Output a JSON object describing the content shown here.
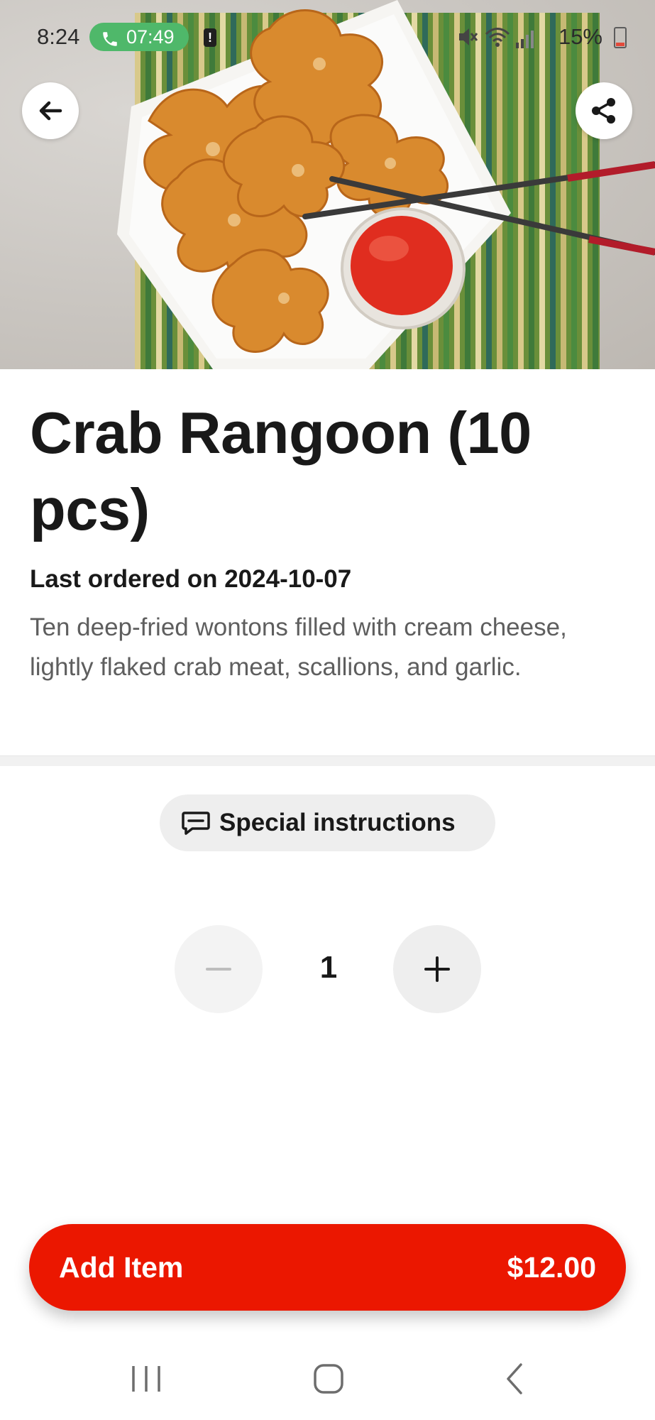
{
  "status_bar": {
    "time": "8:24",
    "call_timer": "07:49",
    "battery": "15%",
    "icons": [
      "phone-icon",
      "alert-icon",
      "mute-icon",
      "wifi-icon",
      "signal-icon",
      "battery-icon"
    ]
  },
  "header": {
    "back_icon": "arrow-left-icon",
    "share_icon": "share-icon"
  },
  "item": {
    "title": "Crab Rangoon (10 pcs)",
    "last_ordered": "Last ordered on 2024-10-07",
    "description": "Ten deep-fried wontons filled with cream cheese, lightly flaked crab meat, scallions, and garlic."
  },
  "special_instructions": {
    "label": "Special instructions",
    "icon": "message-icon"
  },
  "quantity": {
    "value": "1",
    "minus_icon": "minus-icon",
    "plus_icon": "plus-icon"
  },
  "cta": {
    "label": "Add Item",
    "price": "$12.00"
  },
  "colors": {
    "brand": "#eb1700",
    "call_pill": "#4fb86a"
  },
  "nav": {
    "icons": [
      "recent-apps-icon",
      "home-icon",
      "back-icon"
    ]
  }
}
